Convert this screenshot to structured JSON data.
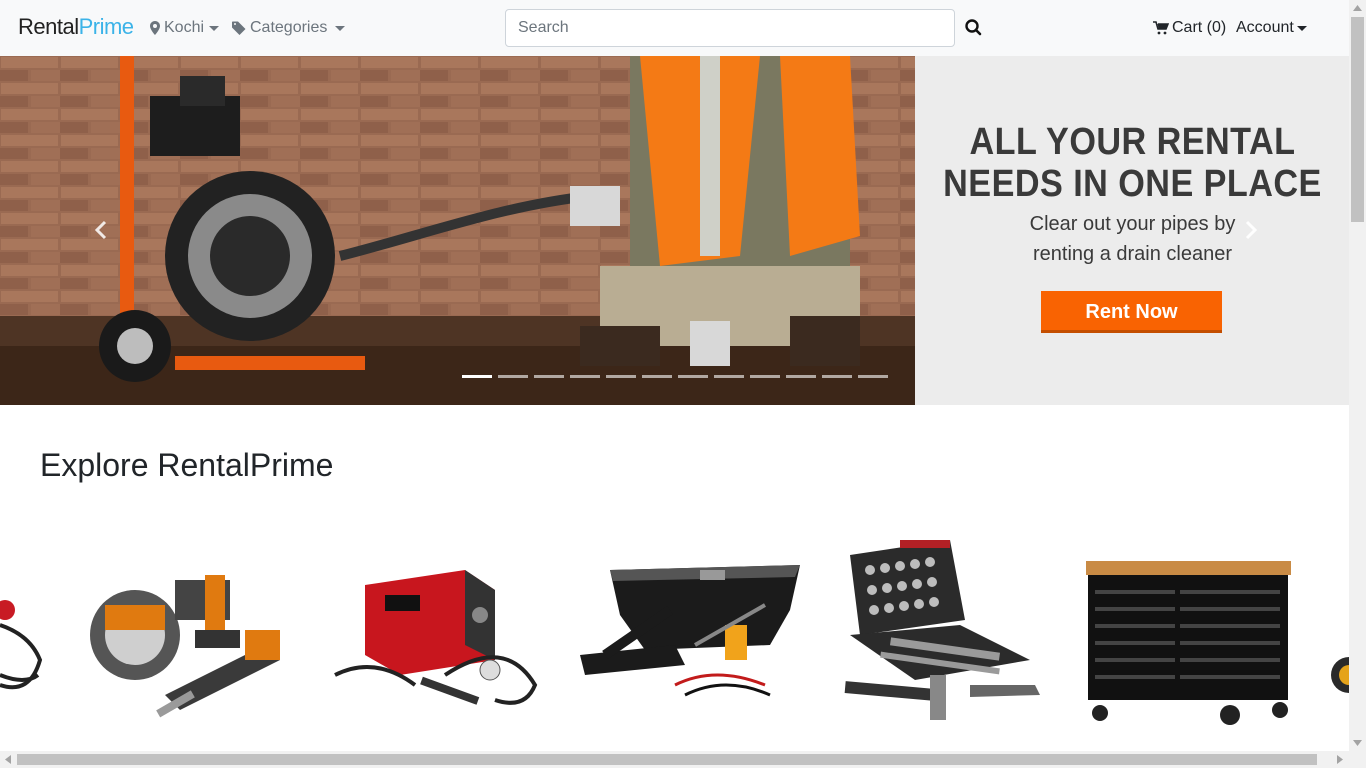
{
  "navbar": {
    "logo_part1": "Rental",
    "logo_part2": "Prime",
    "location": "Kochi",
    "categories": "Categories",
    "search_placeholder": "Search",
    "cart": "Cart (0)",
    "account": "Account"
  },
  "hero": {
    "headline_line1": "ALL YOUR RENTAL",
    "headline_line2": "NEEDS IN ONE PLACE",
    "sub_line1": "Clear out your pipes by",
    "sub_line2": "renting a drain cleaner",
    "cta": "Rent Now",
    "slide_count": 12,
    "active_slide": 0
  },
  "explore": {
    "title": "Explore RentalPrime",
    "products": [
      "power-tool-combo-kit",
      "mig-welder",
      "truck-toolbox-and-jack",
      "mechanics-tool-set",
      "rolling-tool-chest"
    ]
  },
  "colors": {
    "accent": "#f96302",
    "logo_blue": "#3bb3e8",
    "navbar_bg": "#f8f9fa"
  },
  "icons": [
    "map-marker-icon",
    "tag-icon",
    "search-icon",
    "cart-icon",
    "chevron-left-icon",
    "chevron-right-icon"
  ]
}
